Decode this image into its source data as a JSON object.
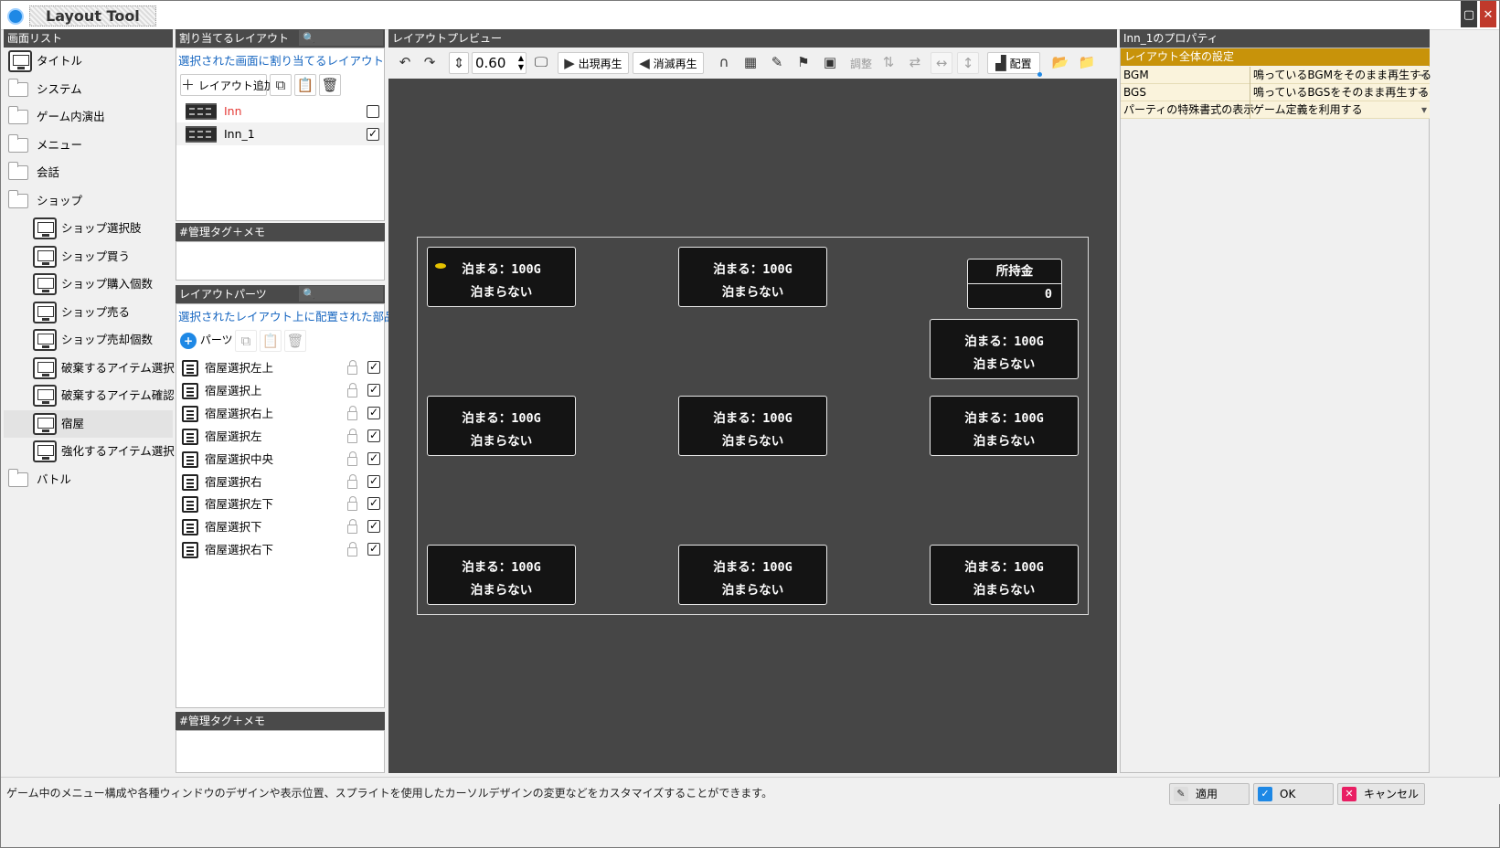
{
  "app": {
    "title": "Layout Tool"
  },
  "screen_list": {
    "header": "画面リスト",
    "items": [
      {
        "label": "タイトル",
        "icon": "monitor-icon"
      },
      {
        "label": "システム",
        "icon": "folder-icon"
      },
      {
        "label": "ゲーム内演出",
        "icon": "folder-icon"
      },
      {
        "label": "メニュー",
        "icon": "folder-icon"
      },
      {
        "label": "会話",
        "icon": "folder-icon"
      },
      {
        "label": "ショップ",
        "icon": "folder-icon"
      },
      {
        "label": "ショップ選択肢",
        "icon": "monitor-icon"
      },
      {
        "label": "ショップ買う",
        "icon": "monitor-icon"
      },
      {
        "label": "ショップ購入個数",
        "icon": "monitor-icon"
      },
      {
        "label": "ショップ売る",
        "icon": "monitor-icon"
      },
      {
        "label": "ショップ売却個数",
        "icon": "monitor-icon"
      },
      {
        "label": "破棄するアイテム選択",
        "icon": "monitor-icon"
      },
      {
        "label": "破棄するアイテム確認",
        "icon": "monitor-icon"
      },
      {
        "label": "宿屋",
        "icon": "monitor-icon",
        "selected": true
      },
      {
        "label": "強化するアイテム選択",
        "icon": "monitor-icon"
      },
      {
        "label": "バトル",
        "icon": "folder-icon"
      }
    ]
  },
  "assign": {
    "header": "割り当てるレイアウト",
    "link": "選択された画面に割り当てるレイアウト",
    "add_label": "レイアウト追加",
    "rows": [
      {
        "label": "Inn",
        "checked": false,
        "color": "#e53935"
      },
      {
        "label": "Inn_1",
        "checked": true
      }
    ],
    "memo_header": "#管理タグ＋メモ"
  },
  "parts": {
    "header": "レイアウトパーツ",
    "link": "選択されたレイアウト上に配置された部品",
    "add_label": "パーツ",
    "rows": [
      "宿屋選択左上",
      "宿屋選択上",
      "宿屋選択右上",
      "宿屋選択左",
      "宿屋選択中央",
      "宿屋選択右",
      "宿屋選択左下",
      "宿屋選択下",
      "宿屋選択右下"
    ],
    "memo_header": "#管理タグ＋メモ"
  },
  "preview": {
    "header": "レイアウトプレビュー",
    "zoom": "0.60",
    "play_appear": "出現再生",
    "play_vanish": "消滅再生",
    "adjust": "調整",
    "arrange": "配置",
    "window_line1": "泊まる：100G",
    "window_line2": "泊まらない",
    "money_title": "所持金",
    "money_value": "0"
  },
  "props": {
    "header": "Inn_1のプロパティ",
    "section": "レイアウト全体の設定",
    "rows": [
      {
        "key": "BGM",
        "value": "鳴っているBGMをそのまま再生する",
        "control": "arrow-right-icon"
      },
      {
        "key": "BGS",
        "value": "鳴っているBGSをそのまま再生する",
        "control": "arrow-right-icon"
      },
      {
        "key": "パーティの特殊書式の表示",
        "value": "ゲーム定義を利用する",
        "control": "dropdown-icon"
      }
    ]
  },
  "status": {
    "text": "ゲーム中のメニュー構成や各種ウィンドウのデザインや表示位置、スプライトを使用したカーソルデザインの変更などをカスタマイズすることができます。",
    "apply": "適用",
    "ok": "OK",
    "cancel": "キャンセル"
  },
  "colors": {
    "accent": "#1565c0",
    "section_header": "#c8930a",
    "preview_bg": "#464646"
  }
}
